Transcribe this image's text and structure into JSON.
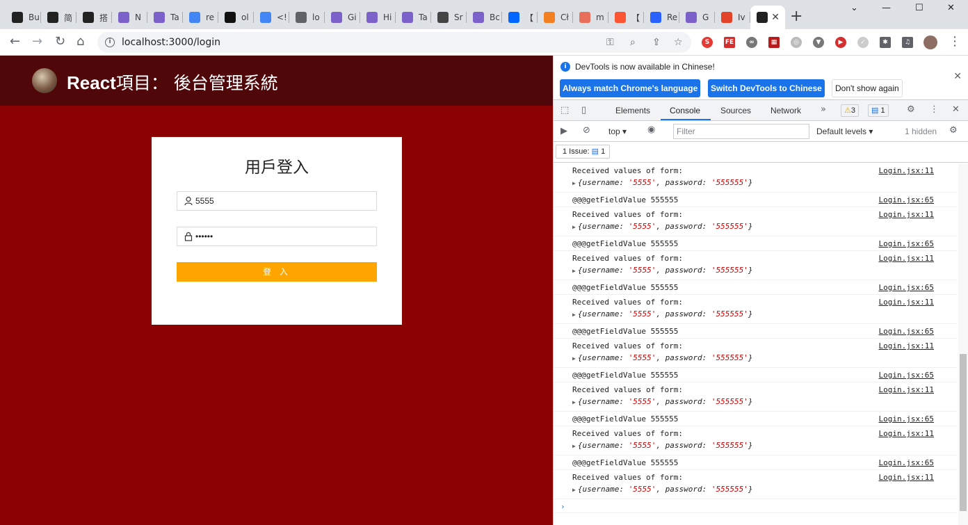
{
  "browser": {
    "tabs": [
      {
        "title": "Bu",
        "icon": "react-icon",
        "color": "#222"
      },
      {
        "title": "简",
        "icon": "react-icon",
        "color": "#222"
      },
      {
        "title": "搭",
        "icon": "react-icon",
        "color": "#222"
      },
      {
        "title": "N",
        "icon": "circle-icon",
        "color": "#7b61c9"
      },
      {
        "title": "Ta",
        "icon": "circle-icon",
        "color": "#7b61c9"
      },
      {
        "title": "re",
        "icon": "google-icon",
        "color": "#4285f4"
      },
      {
        "title": "ol",
        "icon": "github-icon",
        "color": "#111"
      },
      {
        "title": "<!",
        "icon": "google-icon",
        "color": "#4285f4"
      },
      {
        "title": "lo",
        "icon": "globe-icon",
        "color": "#5f6368"
      },
      {
        "title": "Gi",
        "icon": "circle-icon",
        "color": "#7b61c9"
      },
      {
        "title": "Hi",
        "icon": "circle-icon",
        "color": "#7b61c9"
      },
      {
        "title": "Ta",
        "icon": "circle-icon",
        "color": "#7b61c9"
      },
      {
        "title": "Sr",
        "icon": "sourcetree-icon",
        "color": "#444"
      },
      {
        "title": "Bc",
        "icon": "circle-icon",
        "color": "#7b61c9"
      },
      {
        "title": "【",
        "icon": "zhihu-icon",
        "color": "#0066ff"
      },
      {
        "title": "Cł",
        "icon": "a-icon",
        "color": "#f48024"
      },
      {
        "title": "m",
        "icon": "jianshu-icon",
        "color": "#ea6f5a"
      },
      {
        "title": "【",
        "icon": "c-icon",
        "color": "#fc5531"
      },
      {
        "title": "Re",
        "icon": "chat-icon",
        "color": "#2962ff"
      },
      {
        "title": "G",
        "icon": "circle-icon",
        "color": "#7b61c9"
      },
      {
        "title": "Iv",
        "icon": "gitlab-icon",
        "color": "#e24329"
      }
    ],
    "active_tab": {
      "title": "",
      "icon": "react-icon"
    },
    "url": "localhost:3000/login"
  },
  "app": {
    "title_brand": "React",
    "title_rest": "項目： 後台管理系統",
    "login": {
      "heading": "用戶登入",
      "username_value": "5555",
      "password_value": "••••••",
      "submit_label": "登 入"
    },
    "colors": {
      "header_bg": "#4f0709",
      "page_bg": "#8b0000",
      "button_bg": "#ffa500"
    }
  },
  "devtools": {
    "infobar": {
      "message": "DevTools is now available in Chinese!",
      "btn_match": "Always match Chrome's language",
      "btn_switch": "Switch DevTools to Chinese",
      "btn_dismiss": "Don't show again"
    },
    "tabs": [
      "Elements",
      "Console",
      "Sources",
      "Network"
    ],
    "warnings_count": "3",
    "messages_count": "1",
    "context": "top",
    "filter_placeholder": "Filter",
    "levels": "Default levels",
    "hidden": "1 hidden",
    "issues_label": "1 Issue:",
    "issues_count": "1",
    "log": [
      {
        "type": "obj",
        "line1": "Received values of form:",
        "src": "Login.jsx:11"
      },
      {
        "type": "str",
        "line1": "@@@getFieldValue 555555",
        "src": "Login.jsx:65"
      },
      {
        "type": "obj",
        "line1": "Received values of form:",
        "src": "Login.jsx:11"
      },
      {
        "type": "str",
        "line1": "@@@getFieldValue 555555",
        "src": "Login.jsx:65"
      },
      {
        "type": "obj",
        "line1": "Received values of form:",
        "src": "Login.jsx:11"
      },
      {
        "type": "str",
        "line1": "@@@getFieldValue 555555",
        "src": "Login.jsx:65"
      },
      {
        "type": "obj",
        "line1": "Received values of form:",
        "src": "Login.jsx:11"
      },
      {
        "type": "str",
        "line1": "@@@getFieldValue 555555",
        "src": "Login.jsx:65"
      },
      {
        "type": "obj",
        "line1": "Received values of form:",
        "src": "Login.jsx:11"
      },
      {
        "type": "str",
        "line1": "@@@getFieldValue 555555",
        "src": "Login.jsx:65"
      },
      {
        "type": "obj",
        "line1": "Received values of form:",
        "src": "Login.jsx:11"
      },
      {
        "type": "str",
        "line1": "@@@getFieldValue 555555",
        "src": "Login.jsx:65"
      },
      {
        "type": "obj",
        "line1": "Received values of form:",
        "src": "Login.jsx:11"
      },
      {
        "type": "str",
        "line1": "@@@getFieldValue 555555",
        "src": "Login.jsx:65"
      },
      {
        "type": "obj",
        "line1": "Received values of form:",
        "src": "Login.jsx:11"
      }
    ],
    "obj_preview": {
      "username": "5555",
      "password": "555555"
    }
  }
}
